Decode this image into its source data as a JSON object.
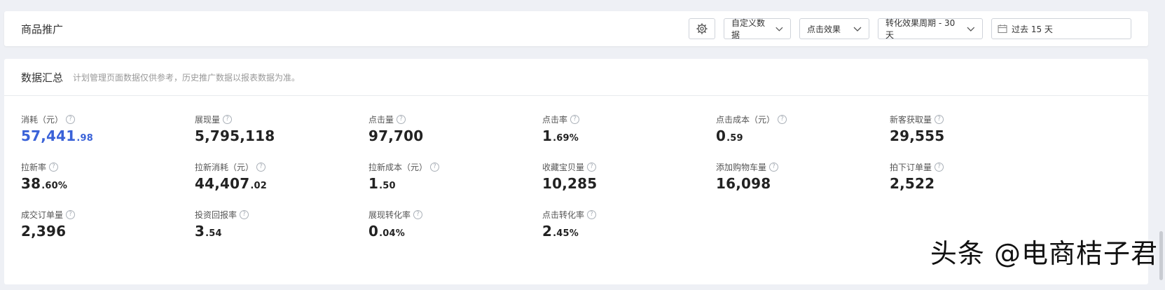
{
  "header": {
    "title": "商品推广",
    "settings_icon": "gear-icon",
    "custom_data_label": "自定义数据",
    "click_effect_label": "点击效果",
    "conversion_period_label": "转化效果周期 - 30天",
    "date_range_label": "过去 15 天",
    "calendar_icon": "calendar-icon"
  },
  "summary": {
    "title": "数据汇总",
    "note": "计划管理页面数据仅供参考，历史推广数据以报表数据为准。"
  },
  "metrics": [
    {
      "label": "消耗（元）",
      "int": "57,441",
      "dec": ".98"
    },
    {
      "label": "展现量",
      "int": "5,795,118",
      "dec": ""
    },
    {
      "label": "点击量",
      "int": "97,700",
      "dec": ""
    },
    {
      "label": "点击率",
      "int": "1",
      "dec": ".69%"
    },
    {
      "label": "点击成本（元）",
      "int": "0",
      "dec": ".59"
    },
    {
      "label": "新客获取量",
      "int": "29,555",
      "dec": ""
    },
    {
      "label": "拉新率",
      "int": "38",
      "dec": ".60%"
    },
    {
      "label": "拉新消耗（元）",
      "int": "44,407",
      "dec": ".02"
    },
    {
      "label": "拉新成本（元）",
      "int": "1",
      "dec": ".50"
    },
    {
      "label": "收藏宝贝量",
      "int": "10,285",
      "dec": ""
    },
    {
      "label": "添加购物车量",
      "int": "16,098",
      "dec": ""
    },
    {
      "label": "拍下订单量",
      "int": "2,522",
      "dec": ""
    },
    {
      "label": "成交订单量",
      "int": "2,396",
      "dec": ""
    },
    {
      "label": "投资回报率",
      "int": "3",
      "dec": ".54"
    },
    {
      "label": "展现转化率",
      "int": "0",
      "dec": ".04%"
    },
    {
      "label": "点击转化率",
      "int": "2",
      "dec": ".45%"
    }
  ],
  "watermark": "头条 @电商桔子君",
  "colors": {
    "accent": "#3a62d8",
    "primary_text": "#222222"
  }
}
